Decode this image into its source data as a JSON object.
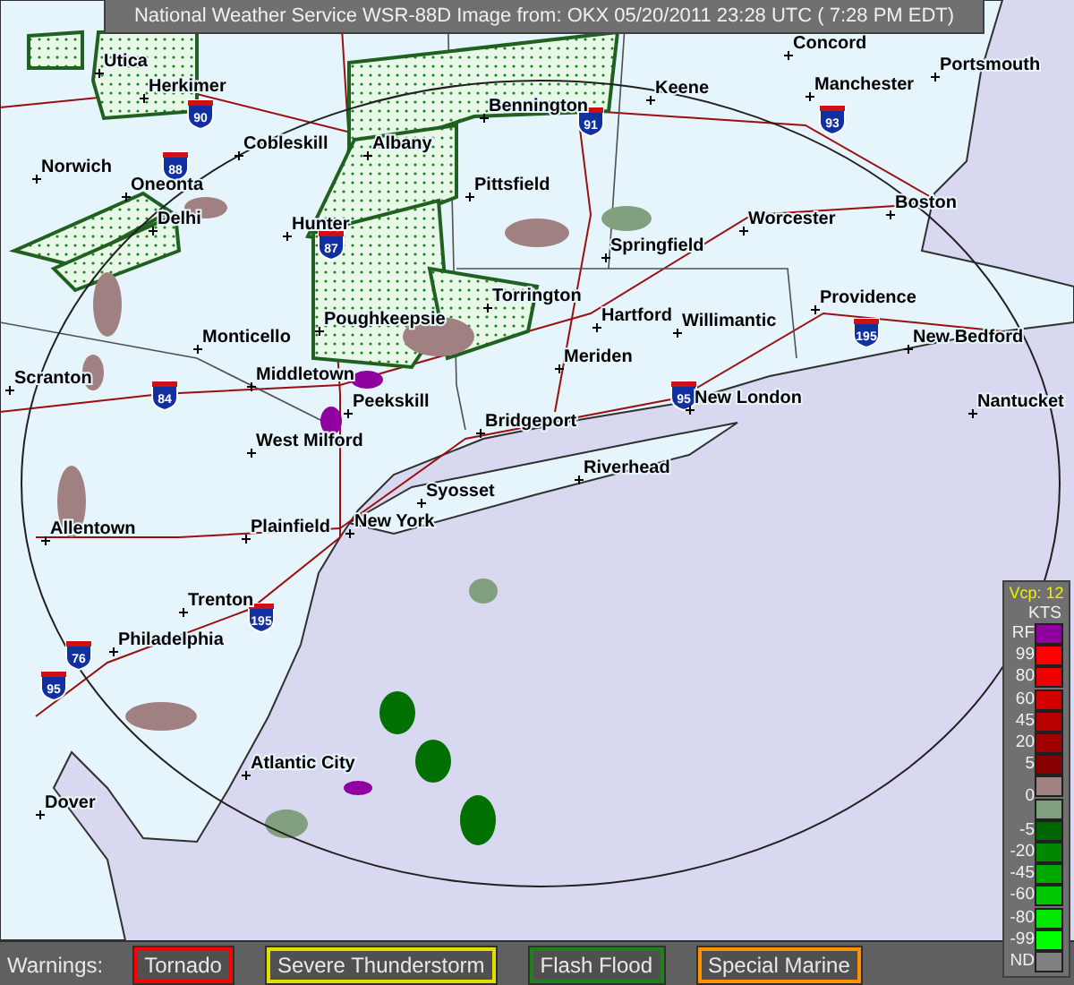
{
  "title": "National Weather Service WSR-88D Image from: OKX 05/20/2011 23:28 UTC ( 7:28 PM EDT)",
  "cities": [
    {
      "name": "Concord"
    },
    {
      "name": "Utica"
    },
    {
      "name": "Portsmouth"
    },
    {
      "name": "Herkimer"
    },
    {
      "name": "Keene"
    },
    {
      "name": "Manchester"
    },
    {
      "name": "Bennington"
    },
    {
      "name": "Cobleskill"
    },
    {
      "name": "Albany"
    },
    {
      "name": "Norwich"
    },
    {
      "name": "Oneonta"
    },
    {
      "name": "Pittsfield"
    },
    {
      "name": "Boston"
    },
    {
      "name": "Delhi"
    },
    {
      "name": "Hunter"
    },
    {
      "name": "Worcester"
    },
    {
      "name": "Springfield"
    },
    {
      "name": "Torrington"
    },
    {
      "name": "Providence"
    },
    {
      "name": "Poughkeepsie"
    },
    {
      "name": "Hartford"
    },
    {
      "name": "Willimantic"
    },
    {
      "name": "Monticello"
    },
    {
      "name": "New Bedford"
    },
    {
      "name": "Meriden"
    },
    {
      "name": "Scranton"
    },
    {
      "name": "Middletown"
    },
    {
      "name": "Peekskill"
    },
    {
      "name": "New London"
    },
    {
      "name": "Nantucket"
    },
    {
      "name": "Bridgeport"
    },
    {
      "name": "West Milford"
    },
    {
      "name": "Riverhead"
    },
    {
      "name": "Syosset"
    },
    {
      "name": "Allentown"
    },
    {
      "name": "Plainfield"
    },
    {
      "name": "New York"
    },
    {
      "name": "Trenton"
    },
    {
      "name": "Philadelphia"
    },
    {
      "name": "Atlantic City"
    },
    {
      "name": "Dover"
    }
  ],
  "highways": [
    {
      "number": "90"
    },
    {
      "number": "88"
    },
    {
      "number": "87"
    },
    {
      "number": "91"
    },
    {
      "number": "93"
    },
    {
      "number": "84"
    },
    {
      "number": "95"
    },
    {
      "number": "195"
    },
    {
      "number": "195"
    },
    {
      "number": "76"
    },
    {
      "number": "95"
    }
  ],
  "legend": {
    "title": "Vcp: 12",
    "unit": "KTS",
    "items": [
      {
        "kind": "swatch",
        "label": "RF",
        "color": "#9000a0"
      },
      {
        "kind": "swatch",
        "label": "99",
        "color": "#ff0000"
      },
      {
        "kind": "swatch",
        "label": "80",
        "color": "#ee0000"
      },
      {
        "kind": "swatch",
        "label": "60",
        "color": "#d40000"
      },
      {
        "kind": "swatch",
        "label": "45",
        "color": "#b80000"
      },
      {
        "kind": "swatch",
        "label": "20",
        "color": "#a00000"
      },
      {
        "kind": "swatch",
        "label": "5",
        "color": "#880000"
      },
      {
        "kind": "swatch",
        "color": "#a08080"
      },
      {
        "kind": "tick",
        "label": "0"
      },
      {
        "kind": "swatch",
        "color": "#80a080"
      },
      {
        "kind": "swatch",
        "label": "-5",
        "color": "#006400"
      },
      {
        "kind": "swatch",
        "label": "-20",
        "color": "#008800"
      },
      {
        "kind": "swatch",
        "label": "-45",
        "color": "#00a800"
      },
      {
        "kind": "swatch",
        "label": "-60",
        "color": "#00c800"
      },
      {
        "kind": "swatch",
        "label": "-80",
        "color": "#00e800"
      },
      {
        "kind": "swatch",
        "label": "-99",
        "color": "#00ff00"
      },
      {
        "kind": "swatch",
        "label": "ND",
        "color": "#808080"
      }
    ]
  },
  "warnings": {
    "label": "Warnings:",
    "items": [
      {
        "label": "Tornado",
        "color": "#ff0000"
      },
      {
        "label": "Severe Thunderstorm",
        "color": "#e0e000"
      },
      {
        "label": "Flash Flood",
        "color": "#208020"
      },
      {
        "label": "Special Marine",
        "color": "#ff9000"
      }
    ]
  }
}
